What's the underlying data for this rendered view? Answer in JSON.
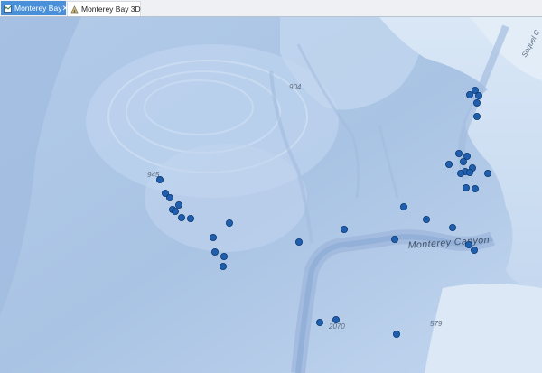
{
  "tabs": [
    {
      "label": "Monterey Bay",
      "icon": "map-icon",
      "active": true
    },
    {
      "label": "Monterey Bay 3D",
      "icon": "globe-3d-icon",
      "active": false
    }
  ],
  "map": {
    "labels": {
      "depth_904": "904",
      "depth_945": "945",
      "depth_2070": "2070",
      "depth_579": "579",
      "canyon": "Monterey Canyon",
      "soquel": "Soquel C"
    },
    "colors": {
      "water": "#b8d0ec",
      "point_fill": "#1f5fae",
      "point_stroke": "#0d3a74",
      "tab_active": "#4a90d9"
    }
  }
}
